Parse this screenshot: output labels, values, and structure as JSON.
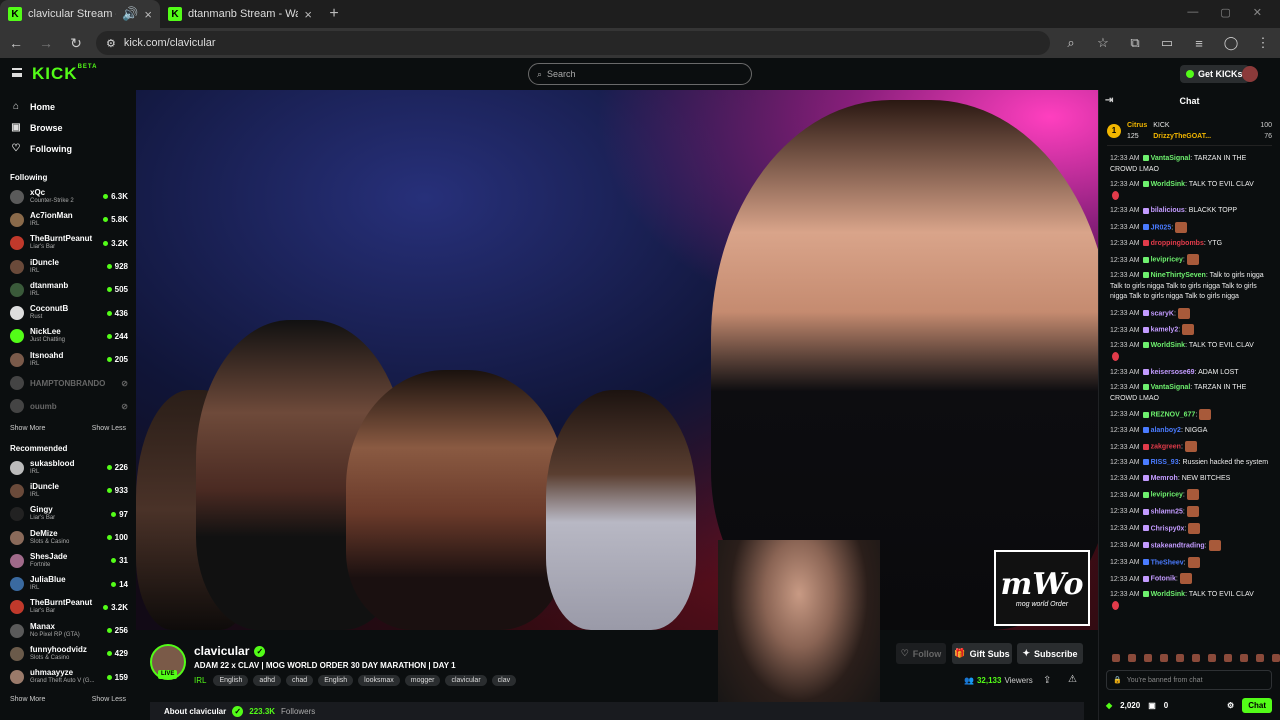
{
  "browser": {
    "tabs": [
      {
        "title": "clavicular Stream - Watch Live",
        "active": true
      },
      {
        "title": "dtanmanb Stream - Watch Live",
        "active": false
      }
    ],
    "url": "kick.com/clavicular"
  },
  "header": {
    "logo": "KICK",
    "logo_badge": "BETA",
    "search_placeholder": "Search",
    "get_kicks": "Get KICKs"
  },
  "sidebar": {
    "nav": [
      {
        "label": "Home",
        "icon": "home-icon"
      },
      {
        "label": "Browse",
        "icon": "browse-icon"
      },
      {
        "label": "Following",
        "icon": "heart-icon"
      }
    ],
    "following_title": "Following",
    "following": [
      {
        "name": "xQc",
        "category": "Counter-Strike 2",
        "viewers": "6.3K",
        "color": "#5a5a5a"
      },
      {
        "name": "Ac7ionMan",
        "category": "IRL",
        "viewers": "5.8K",
        "color": "#8a6a4a"
      },
      {
        "name": "TheBurntPeanut",
        "category": "Liar's Bar",
        "viewers": "3.2K",
        "color": "#c0392b"
      },
      {
        "name": "iDuncle",
        "category": "IRL",
        "viewers": "928",
        "color": "#6a4a3a"
      },
      {
        "name": "dtanmanb",
        "category": "IRL",
        "viewers": "505",
        "color": "#3a5a3a"
      },
      {
        "name": "CoconutB",
        "category": "Rust",
        "viewers": "436",
        "color": "#dddddd"
      },
      {
        "name": "NickLee",
        "category": "Just Chatting",
        "viewers": "244",
        "color": "#53fc18"
      },
      {
        "name": "Itsnoahd",
        "category": "IRL",
        "viewers": "205",
        "color": "#7a5a4a"
      },
      {
        "name": "HAMPTONBRANDO",
        "category": "",
        "viewers": "",
        "color": "#444444",
        "offline": true
      },
      {
        "name": "ouumb",
        "category": "",
        "viewers": "",
        "color": "#444444",
        "offline": true
      }
    ],
    "show_more": "Show More",
    "show_less": "Show Less",
    "recommended_title": "Recommended",
    "recommended": [
      {
        "name": "sukasblood",
        "category": "IRL",
        "viewers": "226",
        "color": "#bbbbbb"
      },
      {
        "name": "iDuncle",
        "category": "IRL",
        "viewers": "933",
        "color": "#6a4a3a"
      },
      {
        "name": "Gingy",
        "category": "Liar's Bar",
        "viewers": "97",
        "color": "#222222"
      },
      {
        "name": "DeMize",
        "category": "Slots & Casino",
        "viewers": "100",
        "color": "#8a6a5a"
      },
      {
        "name": "ShesJade",
        "category": "Fortnite",
        "viewers": "31",
        "color": "#a06a8a"
      },
      {
        "name": "JuliaBlue",
        "category": "IRL",
        "viewers": "14",
        "color": "#3a6aa0"
      },
      {
        "name": "TheBurntPeanut",
        "category": "Liar's Bar",
        "viewers": "3.2K",
        "color": "#c0392b"
      },
      {
        "name": "Manax",
        "category": "No Pixel RP (GTA)",
        "viewers": "256",
        "color": "#5a5a5a"
      },
      {
        "name": "funnyhoodvidz",
        "category": "Slots & Casino",
        "viewers": "429",
        "color": "#6a5a4a"
      },
      {
        "name": "uhmaayyze",
        "category": "Grand Theft Auto V (G...",
        "viewers": "159",
        "color": "#9a7a6a"
      }
    ]
  },
  "video": {
    "watermark_big": "mWo",
    "watermark_small": "mog world Order"
  },
  "stream": {
    "streamer": "clavicular",
    "live_badge": "LIVE",
    "title": "ADAM 22 x CLAV | MOG WORLD ORDER 30 DAY MARATHON | DAY 1",
    "category": "IRL",
    "tags": [
      "English",
      "adhd",
      "chad",
      "English",
      "looksmax",
      "mogger",
      "clavicular",
      "clav"
    ],
    "follow": "Follow",
    "gift_subs": "Gift Subs",
    "subscribe": "Subscribe",
    "viewers": "32,133",
    "viewers_label": "Viewers",
    "about": "About clavicular",
    "followers": "223.3K",
    "followers_label": "Followers"
  },
  "chat": {
    "title": "Chat",
    "pinned": {
      "rank": "1",
      "user1": "Citrus",
      "user1_val": "125",
      "user2_label": "KICK",
      "user2": "DrizzyTheGOAT...",
      "val1": "100",
      "val2": "76"
    },
    "messages": [
      {
        "time": "12:33 AM",
        "user": "VantaSignal",
        "color": "#6ef06e",
        "text": "TARZAN IN THE CROWD LMAO",
        "emote": false,
        "react": false
      },
      {
        "time": "12:33 AM",
        "user": "WorldSink",
        "color": "#6ef06e",
        "text": "TALK TO EVIL CLAV",
        "emote": false,
        "react": true
      },
      {
        "time": "12:33 AM",
        "user": "bilalicious",
        "color": "#c39bff",
        "text": "BLACKK TOPP",
        "emote": false,
        "react": false
      },
      {
        "time": "12:33 AM",
        "user": "JR025",
        "color": "#4a7bff",
        "text": "",
        "emote": true,
        "react": false
      },
      {
        "time": "12:33 AM",
        "user": "droppingbombs",
        "color": "#e23b4a",
        "text": "YTG",
        "emote": false,
        "react": false
      },
      {
        "time": "12:33 AM",
        "user": "levipricey",
        "color": "#6ef06e",
        "text": "",
        "emote": true,
        "react": false
      },
      {
        "time": "12:33 AM",
        "user": "NineThirtySeven",
        "color": "#6ef06e",
        "text": "Talk to girls nigga Talk to girls nigga Talk to girls nigga Talk to girls nigga Talk to girls nigga Talk to girls nigga",
        "emote": false,
        "react": false
      },
      {
        "time": "12:33 AM",
        "user": "scaryK",
        "color": "#c39bff",
        "text": "",
        "emote": true,
        "react": false
      },
      {
        "time": "12:33 AM",
        "user": "kamely2",
        "color": "#c39bff",
        "text": "",
        "emote": true,
        "react": false
      },
      {
        "time": "12:33 AM",
        "user": "WorldSink",
        "color": "#6ef06e",
        "text": "TALK TO EVIL CLAV",
        "emote": false,
        "react": true
      },
      {
        "time": "12:33 AM",
        "user": "keisersose69",
        "color": "#c39bff",
        "text": "ADAM LOST",
        "emote": false,
        "react": false
      },
      {
        "time": "12:33 AM",
        "user": "VantaSignal",
        "color": "#6ef06e",
        "text": "TARZAN IN THE CROWD LMAO",
        "emote": false,
        "react": false
      },
      {
        "time": "12:33 AM",
        "user": "REZNOV_677",
        "color": "#6ef06e",
        "text": "",
        "emote": true,
        "react": false
      },
      {
        "time": "12:33 AM",
        "user": "alanboy2",
        "color": "#4a7bff",
        "text": "NIGGA",
        "emote": false,
        "react": false
      },
      {
        "time": "12:33 AM",
        "user": "zakgreen",
        "color": "#e23b4a",
        "text": "",
        "emote": true,
        "react": false
      },
      {
        "time": "12:33 AM",
        "user": "RISS_93",
        "color": "#4a7bff",
        "text": "Russien hacked the system",
        "emote": false,
        "react": false
      },
      {
        "time": "12:33 AM",
        "user": "Memroh",
        "color": "#c39bff",
        "text": "NEW BITCHES",
        "emote": false,
        "react": false
      },
      {
        "time": "12:33 AM",
        "user": "levipricey",
        "color": "#6ef06e",
        "text": "",
        "emote": true,
        "react": false
      },
      {
        "time": "12:33 AM",
        "user": "shlamn25",
        "color": "#c39bff",
        "text": "",
        "emote": true,
        "react": false
      },
      {
        "time": "12:33 AM",
        "user": "Chrispy0x",
        "color": "#c39bff",
        "text": "",
        "emote": true,
        "react": false
      },
      {
        "time": "12:33 AM",
        "user": "stakeandtrading",
        "color": "#c39bff",
        "text": "",
        "emote": true,
        "react": false
      },
      {
        "time": "12:33 AM",
        "user": "TheSheev",
        "color": "#4a7bff",
        "text": "",
        "emote": true,
        "react": false
      },
      {
        "time": "12:33 AM",
        "user": "Fotonik",
        "color": "#c39bff",
        "text": "",
        "emote": true,
        "react": false
      },
      {
        "time": "12:33 AM",
        "user": "WorldSink",
        "color": "#6ef06e",
        "text": "TALK TO EVIL CLAV",
        "emote": false,
        "react": true
      }
    ],
    "input_placeholder": "You're banned from chat",
    "kicks_balance": "2,020",
    "gift_count": "0",
    "chat_button": "Chat"
  }
}
